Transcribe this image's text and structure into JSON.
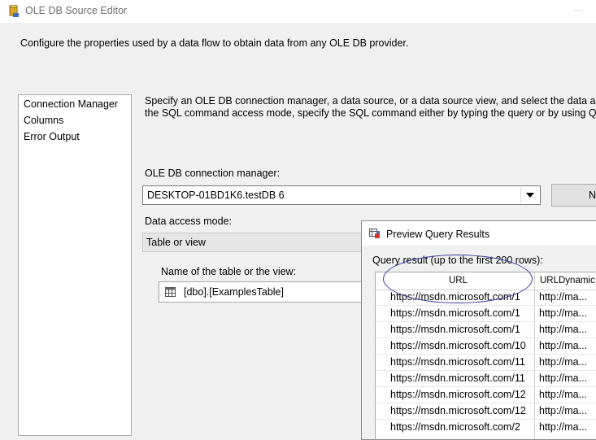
{
  "window": {
    "title": "OLE DB Source Editor"
  },
  "description": "Configure the properties used by a data flow to obtain data from any OLE DB provider.",
  "nav": {
    "items": [
      {
        "label": "Connection Manager"
      },
      {
        "label": "Columns"
      },
      {
        "label": "Error Output"
      }
    ]
  },
  "instructions": {
    "line1": "Specify an OLE DB connection manager, a data source, or a data source view, and select the data access m",
    "line2": "the SQL command access mode, specify the SQL command either by typing the query or by using Query"
  },
  "connection": {
    "label": "OLE DB connection manager:",
    "value": "DESKTOP-01BD1K6.testDB 6",
    "new_button": "N"
  },
  "access_mode": {
    "label": "Data access mode:",
    "value": "Table or view"
  },
  "table_name": {
    "label": "Name of the table or the view:",
    "value": "[dbo].[ExamplesTable]"
  },
  "preview": {
    "title": "Preview Query Results",
    "result_label": "Query result (up to the first 200 rows):",
    "columns": [
      "URL",
      "URLDynamic"
    ],
    "rows": [
      [
        "https://msdn.microsoft.com/1",
        "http://ma..."
      ],
      [
        "https://msdn.microsoft.com/1",
        "http://ma..."
      ],
      [
        "https://msdn.microsoft.com/1",
        "http://ma..."
      ],
      [
        "https://msdn.microsoft.com/10",
        "http://ma..."
      ],
      [
        "https://msdn.microsoft.com/11",
        "http://ma..."
      ],
      [
        "https://msdn.microsoft.com/11",
        "http://ma..."
      ],
      [
        "https://msdn.microsoft.com/12",
        "http://ma..."
      ],
      [
        "https://msdn.microsoft.com/12",
        "http://ma..."
      ],
      [
        "https://msdn.microsoft.com/2",
        "http://ma..."
      ]
    ]
  },
  "colors": {
    "annotation": "#3a3aa0",
    "window_bg": "#f0f0f0"
  }
}
